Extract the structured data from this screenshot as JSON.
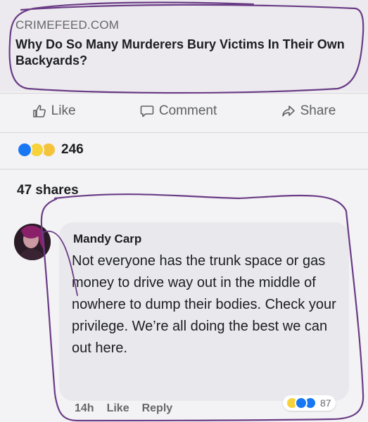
{
  "link_preview": {
    "domain": "CRIMEFEED.COM",
    "headline": "Why Do So Many Murderers Bury Victims In Their Own Backyards?"
  },
  "actions": {
    "like_label": "Like",
    "comment_label": "Comment",
    "share_label": "Share"
  },
  "post_stats": {
    "reaction_count": "246",
    "shares": "47 shares"
  },
  "comment": {
    "author": "Mandy Carp",
    "text": "Not everyone has the trunk space or gas money to drive way out in the middle of nowhere to dump their bodies. Check your privilege. We’re all doing the best we can out here.",
    "time": "14h",
    "like_label": "Like",
    "reply_label": "Reply",
    "reaction_count": "87"
  },
  "colors": {
    "annotation": "#6a3c86",
    "like_blue": "#1877f2",
    "haha_yellow": "#f7d23b"
  }
}
